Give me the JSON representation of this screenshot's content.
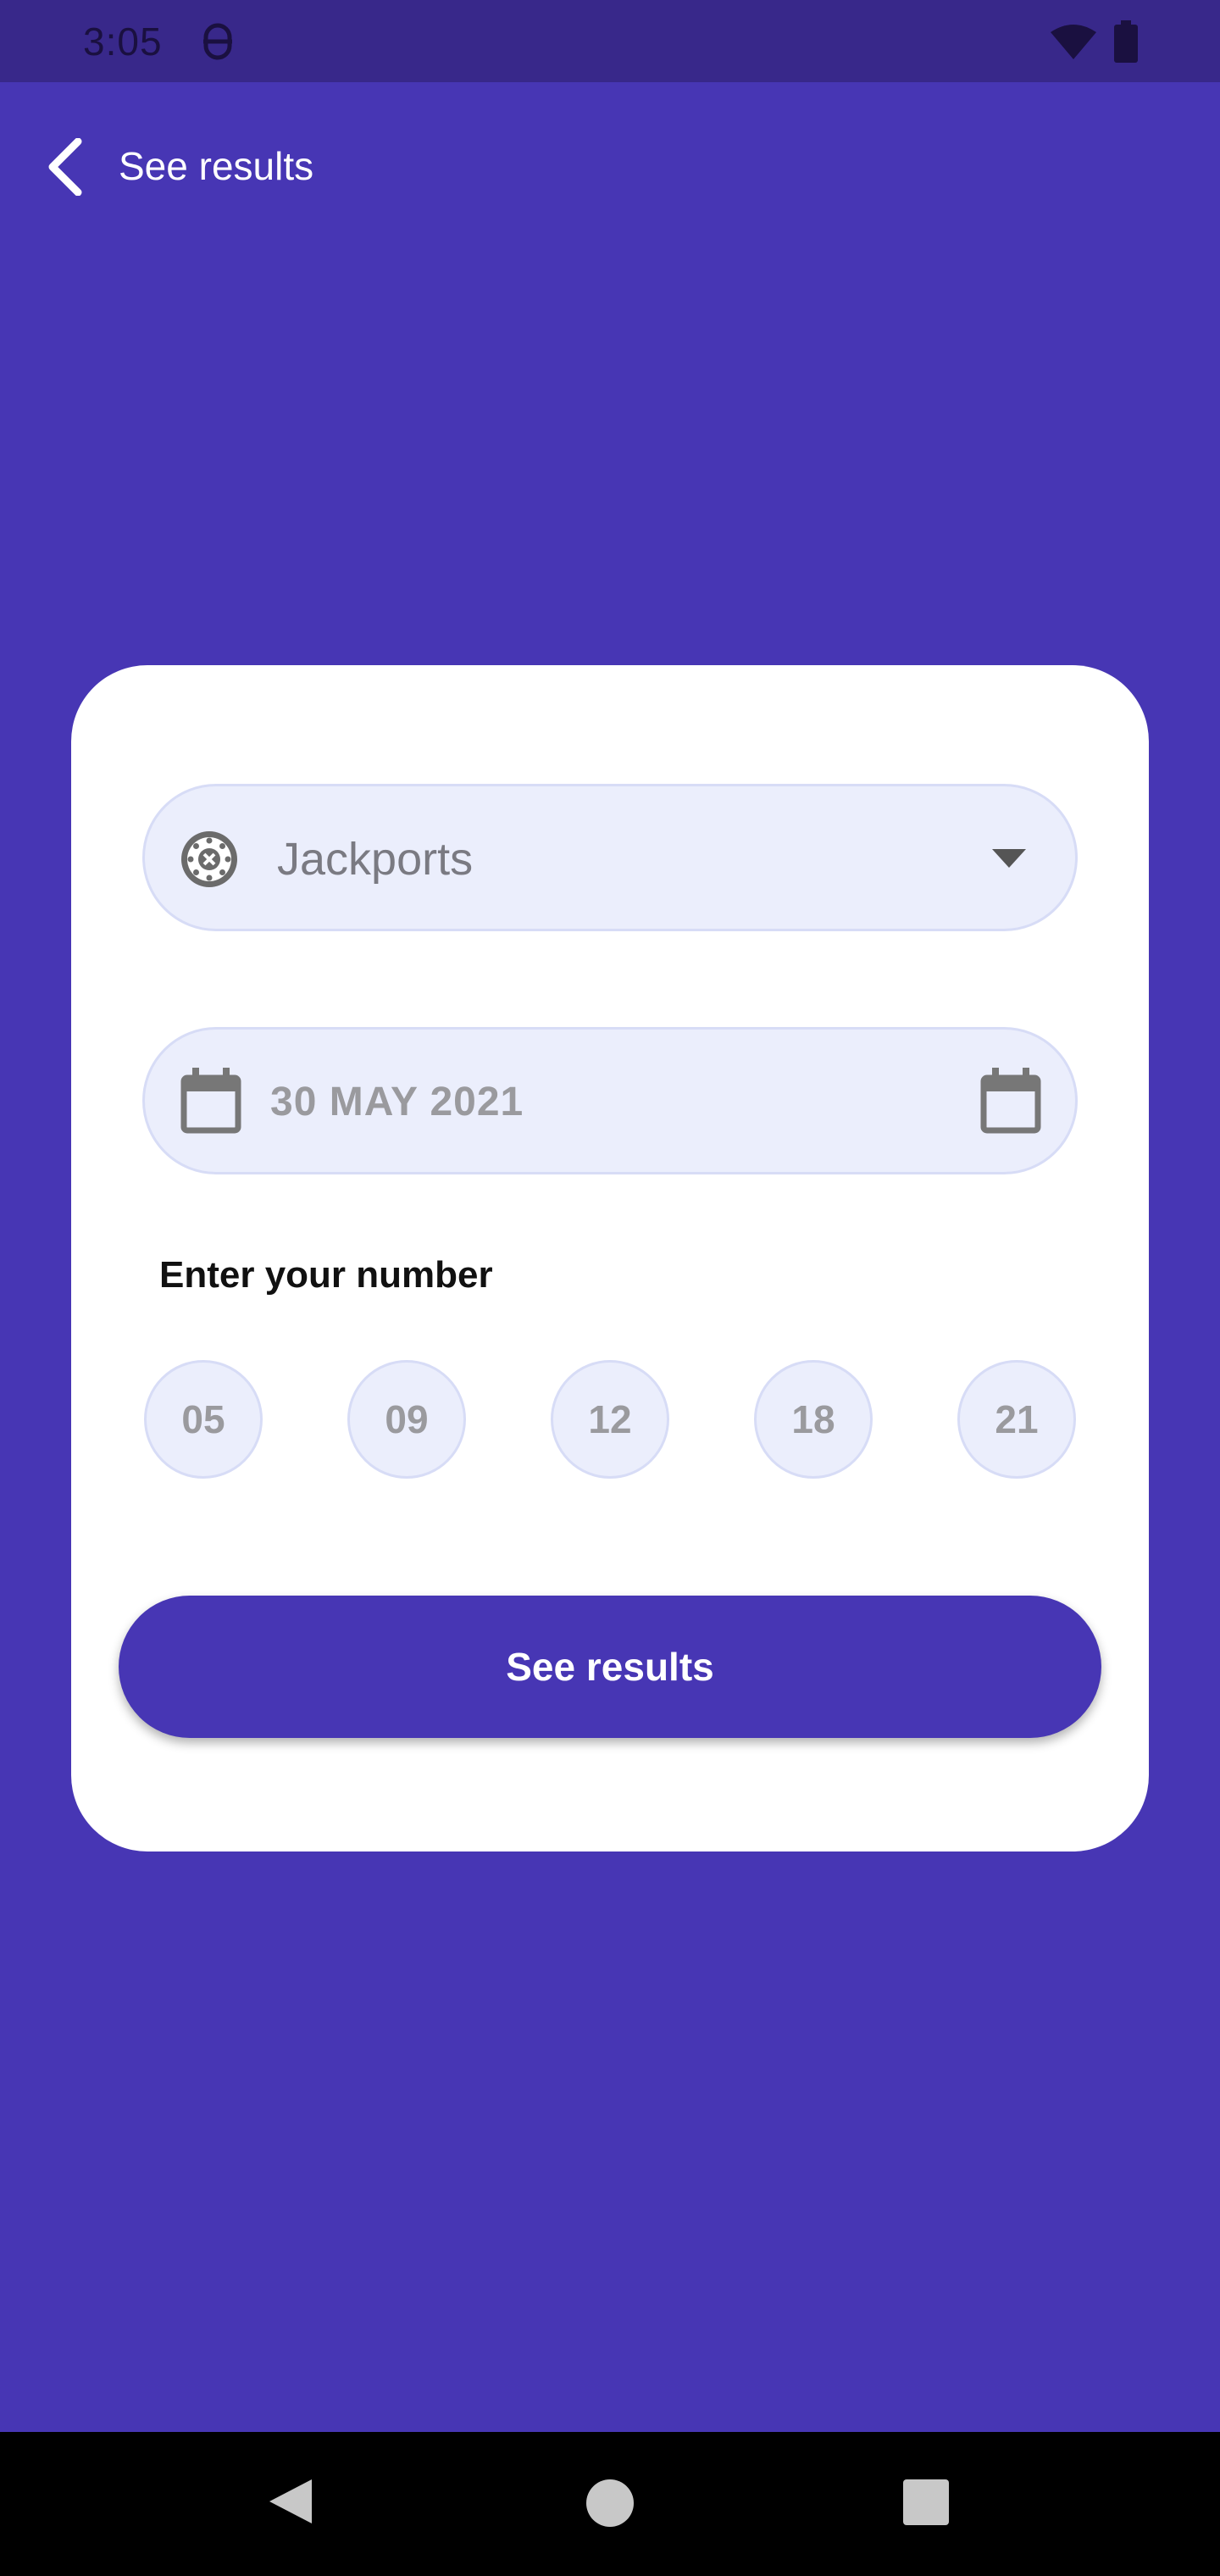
{
  "status_bar": {
    "time": "3:05",
    "icons": [
      "app-notification-icon",
      "wifi-icon",
      "battery-icon"
    ]
  },
  "app_bar": {
    "back_icon": "chevron-left-icon",
    "title": "See results"
  },
  "form": {
    "game_select": {
      "icon": "roulette-icon",
      "selected_value": "Jackports",
      "dropdown_icon": "caret-down-icon"
    },
    "date_field": {
      "value": "30 MAY 2021",
      "icons": [
        "calendar-icon",
        "calendar-icon"
      ]
    },
    "numbers_label": "Enter your number",
    "numbers": [
      "05",
      "09",
      "12",
      "18",
      "21"
    ],
    "submit_label": "See results"
  },
  "nav_bar": {
    "icons": [
      "nav-back-icon",
      "nav-home-icon",
      "nav-recents-icon"
    ]
  },
  "colors": {
    "primary": "#4736b4",
    "status_bar": "#38288a",
    "field_bg": "#ebeefc",
    "card_bg": "#ffffff"
  }
}
